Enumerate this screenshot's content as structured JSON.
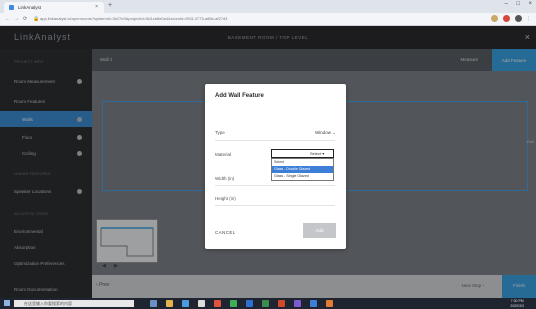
{
  "browser": {
    "tab_title": "LinkAnalyst",
    "tab_close": "×",
    "new_tab": "+",
    "url": "app.linkanalyst.io/openrooms?systemId=3b27e9&projectId=5d1cb8e0a4&roomId=9f15-4773-a88e-af27d3",
    "window_controls": [
      "–",
      "□",
      "×"
    ]
  },
  "header": {
    "logo": "LinkAnalyst",
    "title": "BASEMENT ROOM / TOP LEVEL",
    "close": "×"
  },
  "sidebar": {
    "items": [
      {
        "label": "PROJECT INFO",
        "kind": "section"
      },
      {
        "label": "Room Measurement",
        "kind": "item"
      },
      {
        "label": "Room Features",
        "kind": "item"
      },
      {
        "label": "Walls",
        "kind": "active"
      },
      {
        "label": "Floor",
        "kind": "sub"
      },
      {
        "label": "Ceiling",
        "kind": "sub"
      },
      {
        "label": "LINEAR FEATURES",
        "kind": "section"
      },
      {
        "label": "Speaker Locations",
        "kind": "item"
      },
      {
        "label": "ACOUSTIC ITEMS",
        "kind": "section"
      },
      {
        "label": "Environmental",
        "kind": "item"
      },
      {
        "label": "Absorption",
        "kind": "item"
      },
      {
        "label": "Optimization Preferences",
        "kind": "item"
      },
      {
        "label": "Room Documentation",
        "kind": "item"
      }
    ]
  },
  "main": {
    "floor_name": "Wall 1",
    "measure_label": "Measure",
    "add_button": "Add Feature",
    "side_label": "Wall",
    "bottom_left": "Prev",
    "bottom_right": "Next Step",
    "bottom_button": "Finish"
  },
  "modal": {
    "title": "Add Wall Feature",
    "type_label": "Type",
    "type_value": "Window",
    "material_label": "Material",
    "material_selected": "Select",
    "material_options": [
      "Select",
      "Glass - Double Glazed",
      "Glass - Single Glazed"
    ],
    "material_highlighted_index": 1,
    "width_label": "Width (in)",
    "height_label": "Height (in)",
    "cancel_label": "CANCEL",
    "save_label": "Add"
  },
  "taskbar": {
    "search_placeholder": "在这里输入你要搜索的内容",
    "time": "7:30 PM",
    "date": "2020/3/3"
  },
  "colors": {
    "accent": "#3ba3e6",
    "header": "#2b2b2e",
    "sidebar": "#2f3033",
    "selected_option": "#3d7fd6"
  }
}
